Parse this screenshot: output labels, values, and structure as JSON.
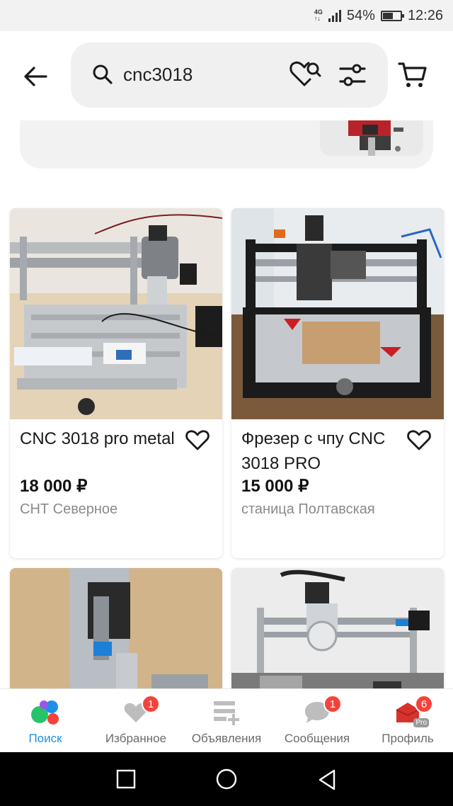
{
  "status_bar": {
    "network": "4G",
    "battery_percent": "54%",
    "battery_level": 0.54,
    "time": "12:26"
  },
  "header": {
    "search": {
      "value": "cnc3018"
    },
    "icons": [
      "back-arrow-icon",
      "search-icon",
      "favorite-search-icon",
      "filter-icon",
      "cart-icon"
    ]
  },
  "listings": [
    {
      "title": "CNC 3018 pro metal",
      "price": "18 000 ₽",
      "location": "СНТ Северное"
    },
    {
      "title": "Фрезер с чпу CNC 3018 PRO",
      "price": "15 000 ₽",
      "location": "станица Полтавская"
    },
    {
      "title": "",
      "price": "",
      "location": ""
    },
    {
      "title": "",
      "price": "",
      "location": ""
    }
  ],
  "bottom_nav": {
    "items": [
      {
        "label": "Поиск",
        "icon": "search-dots-icon",
        "active": true
      },
      {
        "label": "Избранное",
        "icon": "heart-icon",
        "badge": "1"
      },
      {
        "label": "Объявления",
        "icon": "add-listing-icon"
      },
      {
        "label": "Сообщения",
        "icon": "chat-icon",
        "badge": "1"
      },
      {
        "label": "Профиль",
        "icon": "profile-icon",
        "badge": "6",
        "tag": "Pro"
      }
    ]
  },
  "colors": {
    "accent": "#1d8fe8",
    "badge": "#f5433b",
    "search_bg": "#f0f0f0",
    "muted_text": "#8a8a8a"
  }
}
